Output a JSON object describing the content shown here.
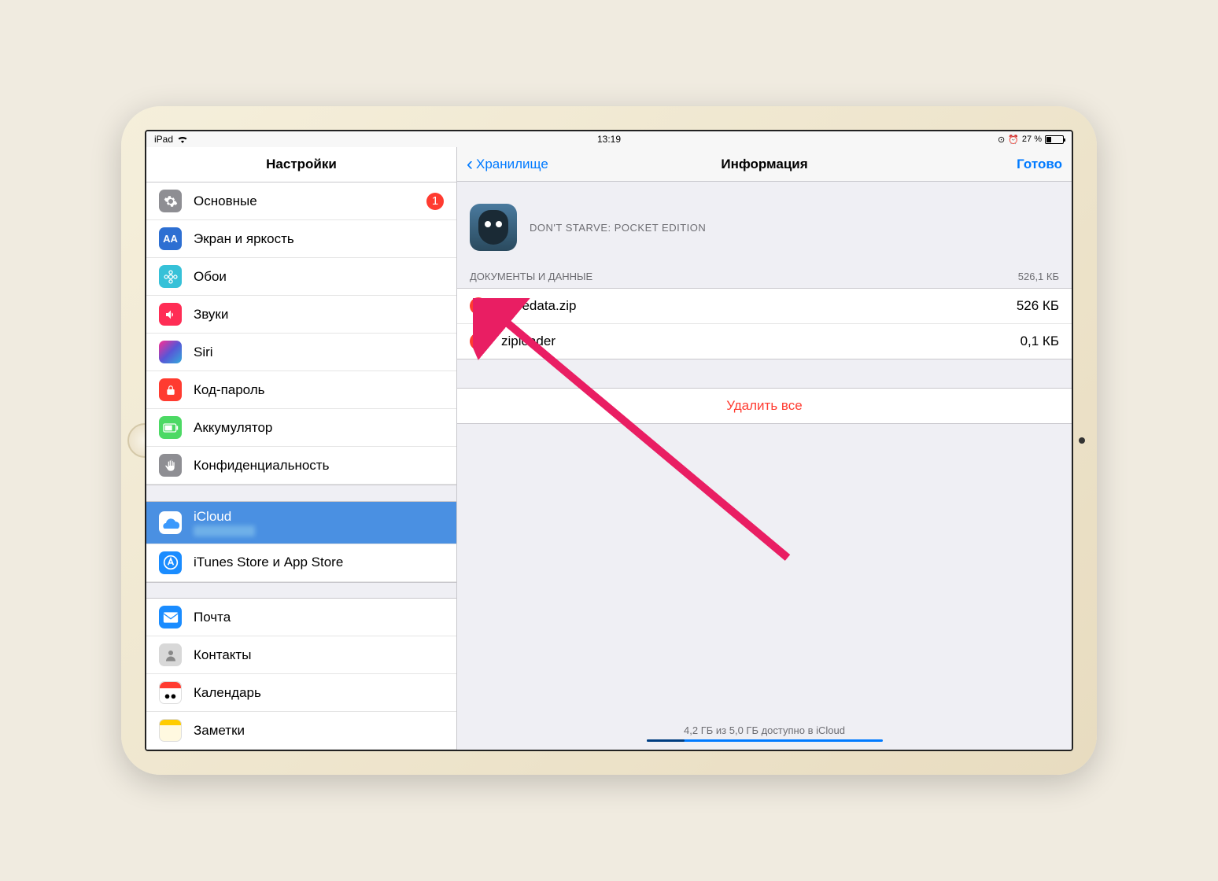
{
  "status": {
    "device": "iPad",
    "time": "13:19",
    "battery_pct": "27 %"
  },
  "sidebar": {
    "title": "Настройки",
    "rows": [
      {
        "label": "Основные",
        "badge": "1",
        "icon_bg": "#8e8e93",
        "icon": "gear"
      },
      {
        "label": "Экран и яркость",
        "icon_bg": "#2d6fd2",
        "icon": "aA"
      },
      {
        "label": "Обои",
        "icon_bg": "#36c1d8",
        "icon": "flower"
      },
      {
        "label": "Звуки",
        "icon_bg": "#ff2d55",
        "icon": "speaker"
      },
      {
        "label": "Siri",
        "icon_bg": "grad",
        "icon": "siri"
      },
      {
        "label": "Код-пароль",
        "icon_bg": "#ff3b30",
        "icon": "lock"
      },
      {
        "label": "Аккумулятор",
        "icon_bg": "#4cd964",
        "icon": "battery"
      },
      {
        "label": "Конфиденциальность",
        "icon_bg": "#8e8e93",
        "icon": "hand"
      }
    ],
    "cloud_rows": [
      {
        "label": "iCloud",
        "selected": true,
        "icon_bg": "#fff",
        "icon": "cloud"
      },
      {
        "label": "iTunes Store и App Store",
        "icon_bg": "#1a8cff",
        "icon": "appstore"
      }
    ],
    "app_rows": [
      {
        "label": "Почта",
        "icon_bg": "#1a8cff",
        "icon": "mail"
      },
      {
        "label": "Контакты",
        "icon_bg": "#d8d8d8",
        "icon": "contacts"
      },
      {
        "label": "Календарь",
        "icon_bg": "#fff",
        "icon": "calendar"
      },
      {
        "label": "Заметки",
        "icon_bg": "#ffcc00",
        "icon": "notes"
      }
    ]
  },
  "detail": {
    "back_label": "Хранилище",
    "title": "Информация",
    "done_label": "Готово",
    "app_name": "DON'T STARVE: POCKET EDITION",
    "section_label": "ДОКУМЕНТЫ И ДАННЫЕ",
    "section_size": "526,1 КБ",
    "files": [
      {
        "name": "savedata.zip",
        "size": "526 КБ"
      },
      {
        "name": "ziploader",
        "size": "0,1 КБ"
      }
    ],
    "delete_all": "Удалить все",
    "storage_text": "4,2 ГБ из 5,0 ГБ доступно в iCloud"
  }
}
